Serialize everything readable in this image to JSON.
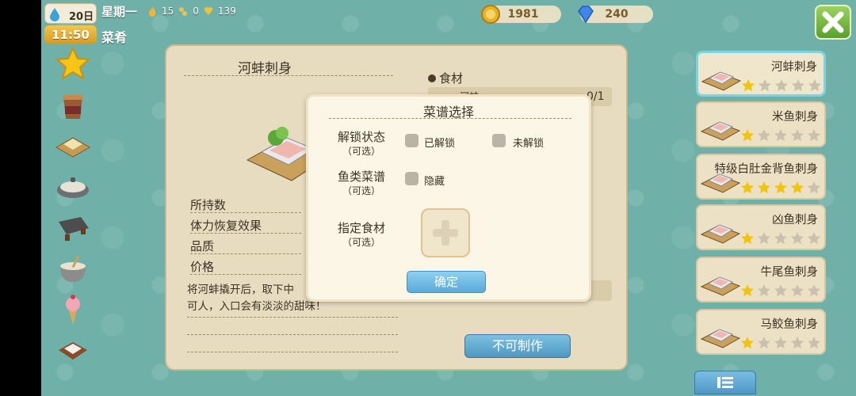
{
  "hud": {
    "day": "20日",
    "time": "11:50",
    "weekday": "星期一",
    "stat1": "15",
    "stat2": "0",
    "stat3": "139",
    "section": "菜肴"
  },
  "currency": {
    "coins": "1981",
    "gems": "240"
  },
  "categories": [
    {
      "icon": "star-icon"
    },
    {
      "icon": "bucket-icon"
    },
    {
      "icon": "sashimi-board-icon"
    },
    {
      "icon": "pot-icon"
    },
    {
      "icon": "grill-icon"
    },
    {
      "icon": "bowl-icon"
    },
    {
      "icon": "ice-cream-icon"
    },
    {
      "icon": "box-icon"
    }
  ],
  "detail": {
    "title": "河蚌刺身",
    "rows": [
      "所持数",
      "体力恢复效果",
      "品质",
      "价格"
    ],
    "description": "将河蚌撬开后，取下中　　　　　　　　白净可人，入口会有淡淡的甜味！",
    "ingredients_header": "食材",
    "ingredient_name": "河蚌",
    "ingredient_count": "0/1",
    "action_button": "不可制作"
  },
  "dialog": {
    "title": "菜谱选择",
    "unlock_label": "解锁状态",
    "unlock_sub": "（可选）",
    "unlocked": "已解锁",
    "locked": "未解锁",
    "fish_label": "鱼类菜谱",
    "fish_sub": "（可选）",
    "hidden": "隐藏",
    "ingredient_label": "指定食材",
    "ingredient_sub": "（可选）",
    "confirm": "确定"
  },
  "recipes": [
    {
      "name": "河蚌刺身",
      "stars": 1,
      "selected": true
    },
    {
      "name": "米鱼刺身",
      "stars": 1,
      "selected": false
    },
    {
      "name": "特级白肚金背鱼刺身",
      "stars": 4,
      "selected": false
    },
    {
      "name": "凶鱼刺身",
      "stars": 1,
      "selected": false
    },
    {
      "name": "牛尾鱼刺身",
      "stars": 1,
      "selected": false
    },
    {
      "name": "马鲛鱼刺身",
      "stars": 1,
      "selected": false
    }
  ],
  "colors": {
    "star_on": "#f1c40f",
    "star_off": "#c9c1ad",
    "accent": "#5aa9d9"
  }
}
